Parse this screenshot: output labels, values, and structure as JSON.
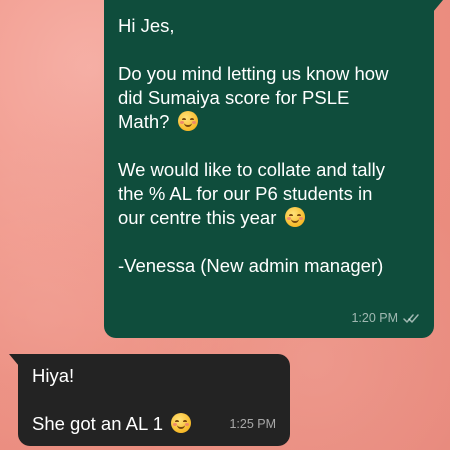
{
  "chat": {
    "outgoing": {
      "lines": [
        "Hi Jes,",
        "",
        "Do you mind letting us know how",
        "did Sumaiya score for PSLE",
        "Math?",
        "",
        "We would like to collate and tally",
        "the % AL for our P6 students in",
        "our centre this year",
        "",
        "-Venessa (New admin manager)"
      ],
      "time": "1:20 PM",
      "status_icon": "double-check-icon"
    },
    "incoming": {
      "lines": [
        "Hiya!",
        "",
        "She got an AL 1"
      ],
      "time": "1:25 PM"
    }
  },
  "colors": {
    "outgoing_bubble": "#0f4d3c",
    "incoming_bubble": "#232323",
    "wallpaper": "#ec8e80"
  }
}
